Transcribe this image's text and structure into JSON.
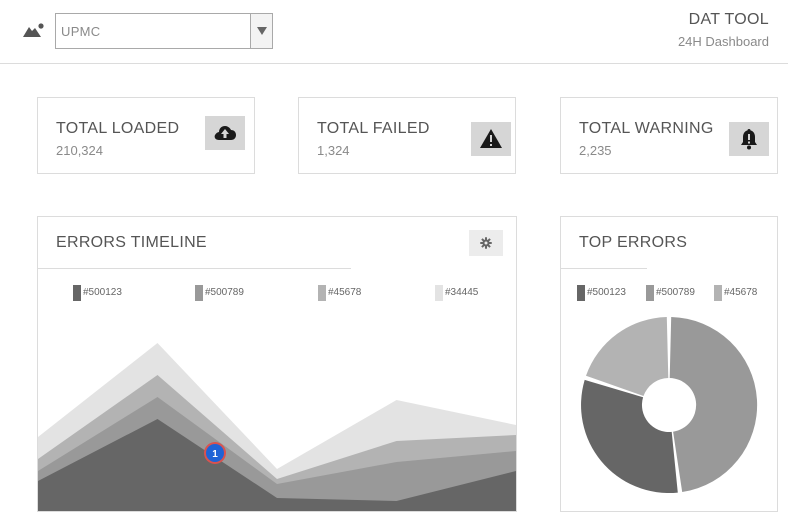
{
  "header": {
    "org_select": {
      "value": "UPMC"
    },
    "app_title": "DAT TOOL",
    "app_subtitle": "24H Dashboard"
  },
  "stats": [
    {
      "label": "TOTAL LOADED",
      "value": "210,324",
      "icon": "cloud-upload-icon"
    },
    {
      "label": "TOTAL FAILED",
      "value": "1,324",
      "icon": "warning-icon"
    },
    {
      "label": "TOTAL WARNING",
      "value": "2,235",
      "icon": "bell-alert-icon"
    }
  ],
  "errors_timeline": {
    "title": "ERRORS TIMELINE",
    "settings_icon": "gear-icon",
    "marker_label": "1",
    "legend": [
      {
        "label": "#500123",
        "color": "#666666"
      },
      {
        "label": "#500789",
        "color": "#999999"
      },
      {
        "label": "#45678",
        "color": "#b3b3b3"
      },
      {
        "label": "#34445",
        "color": "#e3e3e3"
      }
    ]
  },
  "top_errors": {
    "title": "TOP ERRORS",
    "legend": [
      {
        "label": "#500123",
        "color": "#666666"
      },
      {
        "label": "#500789",
        "color": "#999999"
      },
      {
        "label": "#45678",
        "color": "#b3b3b3"
      }
    ]
  },
  "chart_data": [
    {
      "type": "area",
      "stacked": true,
      "x": [
        0,
        1,
        2,
        3,
        4
      ],
      "series": [
        {
          "name": "#500123",
          "values": [
            30,
            92,
            13,
            10,
            40
          ]
        },
        {
          "name": "#500789",
          "values": [
            10,
            22,
            14,
            39,
            20
          ]
        },
        {
          "name": "#45678",
          "values": [
            12,
            22,
            5,
            21,
            16
          ]
        },
        {
          "name": "#34445",
          "values": [
            22,
            32,
            10,
            41,
            10
          ]
        }
      ],
      "ylim": [
        0,
        195
      ],
      "grid": false,
      "legend": "top"
    },
    {
      "type": "pie",
      "donut": true,
      "series": [
        {
          "name": "#500789",
          "value": 48
        },
        {
          "name": "#500123",
          "value": 32
        },
        {
          "name": "#45678",
          "value": 20
        }
      ],
      "colors": [
        "#999999",
        "#666666",
        "#b3b3b3"
      ]
    }
  ]
}
